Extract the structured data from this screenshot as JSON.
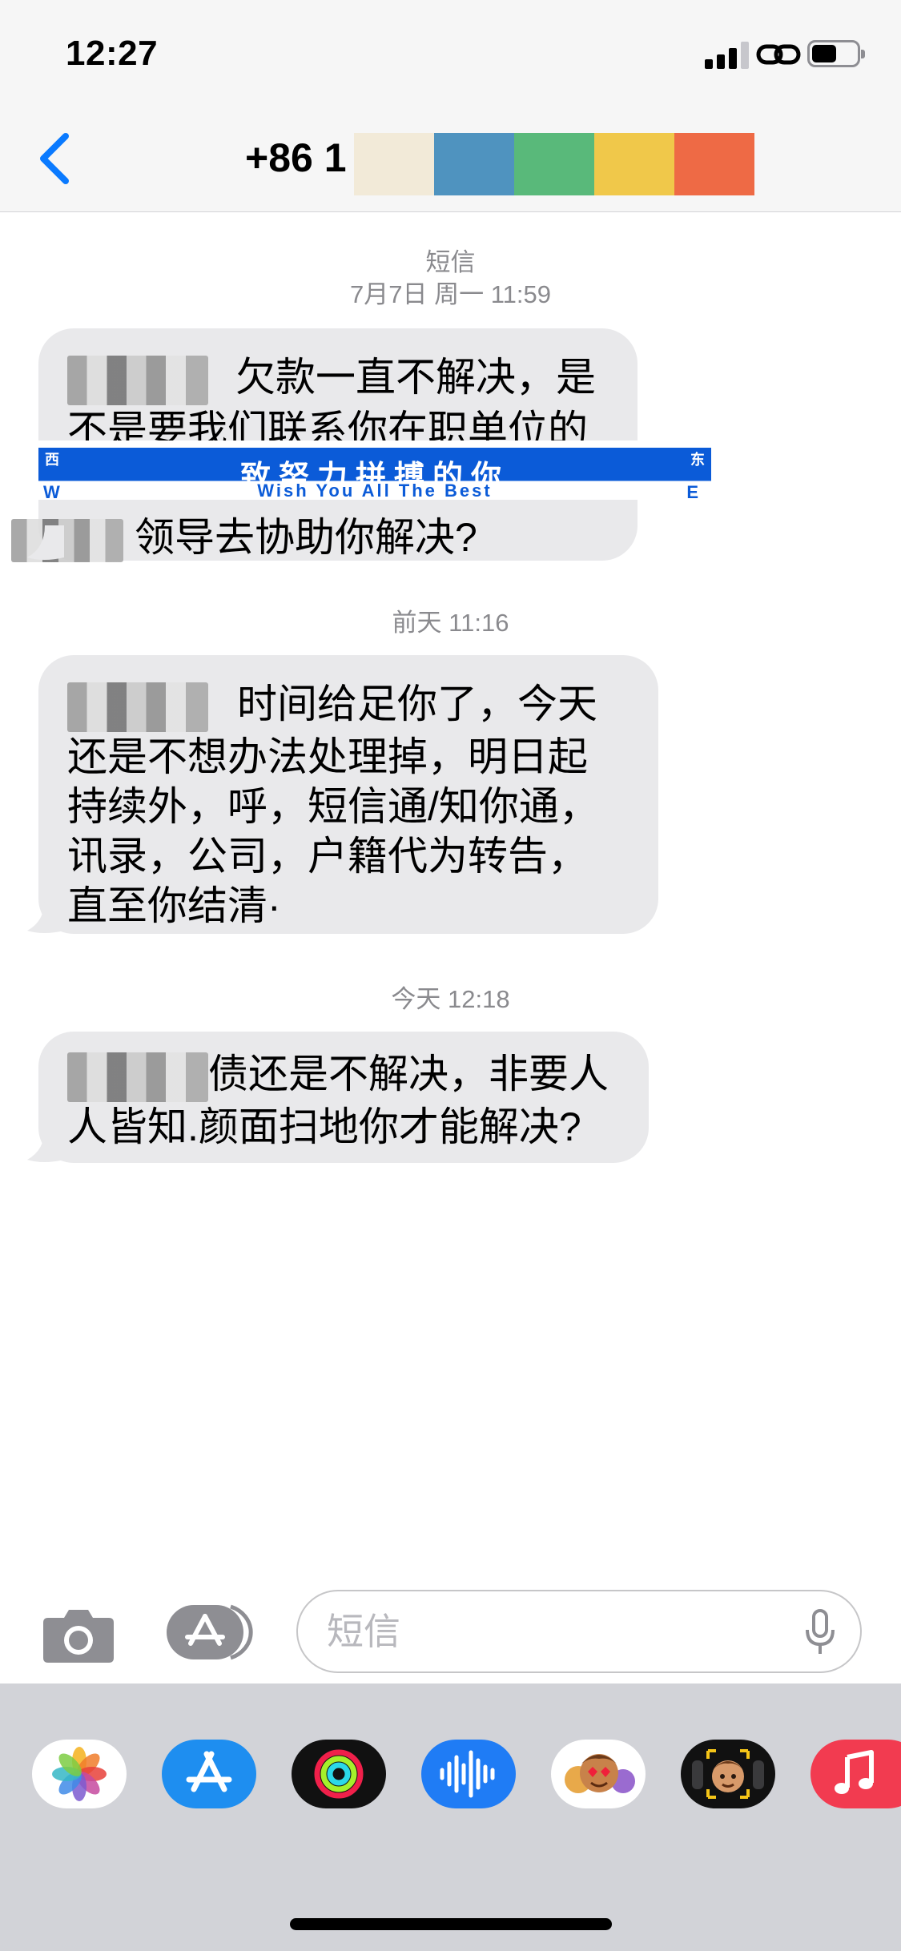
{
  "status_bar": {
    "time": "12:27"
  },
  "nav": {
    "contact": "+86 1"
  },
  "messages": [
    {
      "service": "短信",
      "timestamp": "7月7日 周一 11:59",
      "lines": [
        "欠款一直不解决，是",
        "不是要我们联系你在职单位的",
        "领导去协助你解决?"
      ],
      "overlay": {
        "main": "致努力拼搏的你",
        "sub": "Wish You All The Best",
        "left_corner": "西",
        "right_corner": "东",
        "w": "W",
        "e": "E"
      }
    },
    {
      "timestamp": "前天 11:16",
      "lines": [
        "时间给足你了，今天",
        "还是不想办法处理掉，明日起",
        "持续外，呼，短信通/知你通，",
        "讯录，公司，户籍代为转告，",
        "直至你结清·"
      ]
    },
    {
      "timestamp": "今天 12:18",
      "lines": [
        "债还是不解决，非要人",
        "人皆知.颜面扫地你才能解决?"
      ]
    }
  ],
  "compose": {
    "placeholder": "短信"
  },
  "app_drawer": [
    {
      "name": "photos-app-icon",
      "color": "#ffffff"
    },
    {
      "name": "app-store-icon",
      "color": "#1e8ef0"
    },
    {
      "name": "fitness-app-icon",
      "color": "#111111"
    },
    {
      "name": "audio-message-icon",
      "color": "#1f7cf5"
    },
    {
      "name": "memoji-stickers-icon",
      "color": "#ffffff"
    },
    {
      "name": "memoji-icon",
      "color": "#111111"
    },
    {
      "name": "music-app-icon",
      "color": "#f23b50"
    }
  ],
  "colors": {
    "ios_blue": "#0a7aff",
    "bubble_gray": "#e9e9eb",
    "meta_gray": "#8a8a8e",
    "drawer_gray": "#d2d3d8"
  }
}
